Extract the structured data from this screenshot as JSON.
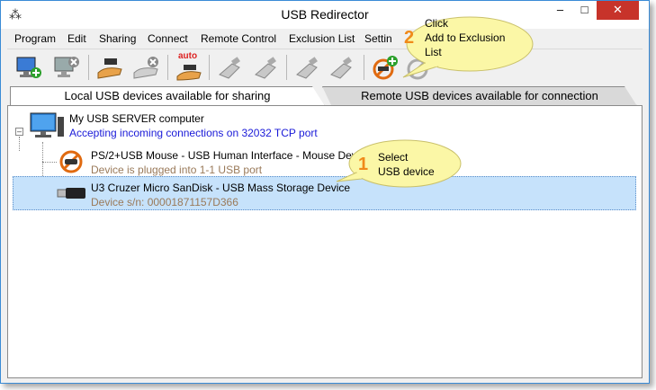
{
  "window": {
    "title": "USB Redirector",
    "controls": {
      "minimize": "–",
      "maximize": "□",
      "close": "✕"
    }
  },
  "menu": [
    "Program",
    "Edit",
    "Sharing",
    "Connect",
    "Remote Control",
    "Exclusion List",
    "Settin"
  ],
  "toolbar": {
    "auto_label": "auto"
  },
  "tabs": {
    "local": "Local USB devices available for sharing",
    "remote": "Remote USB devices available for connection"
  },
  "tree": {
    "server": {
      "name": "My USB SERVER computer",
      "status": "Accepting incoming connections on 32032 TCP port"
    },
    "devices": [
      {
        "name": "PS/2+USB Mouse - USB Human Interface - Mouse Devic",
        "detail": "Device is plugged into 1-1 USB port"
      },
      {
        "name": "U3 Cruzer Micro SanDisk - USB Mass Storage Device",
        "detail": "Device s/n: 00001871157D366"
      }
    ]
  },
  "callouts": {
    "step1": {
      "num": "1",
      "line1": "Select",
      "line2": "USB device"
    },
    "step2": {
      "num": "2",
      "line1": "Click",
      "line2": "Add to Exclusion",
      "line3": "List"
    }
  },
  "colors": {
    "selection": "#c6e2fb",
    "callout_bg": "#fbf7a6",
    "callout_number": "#f08a1a",
    "status_blue": "#1a1ad8",
    "close_button": "#c7332a"
  }
}
